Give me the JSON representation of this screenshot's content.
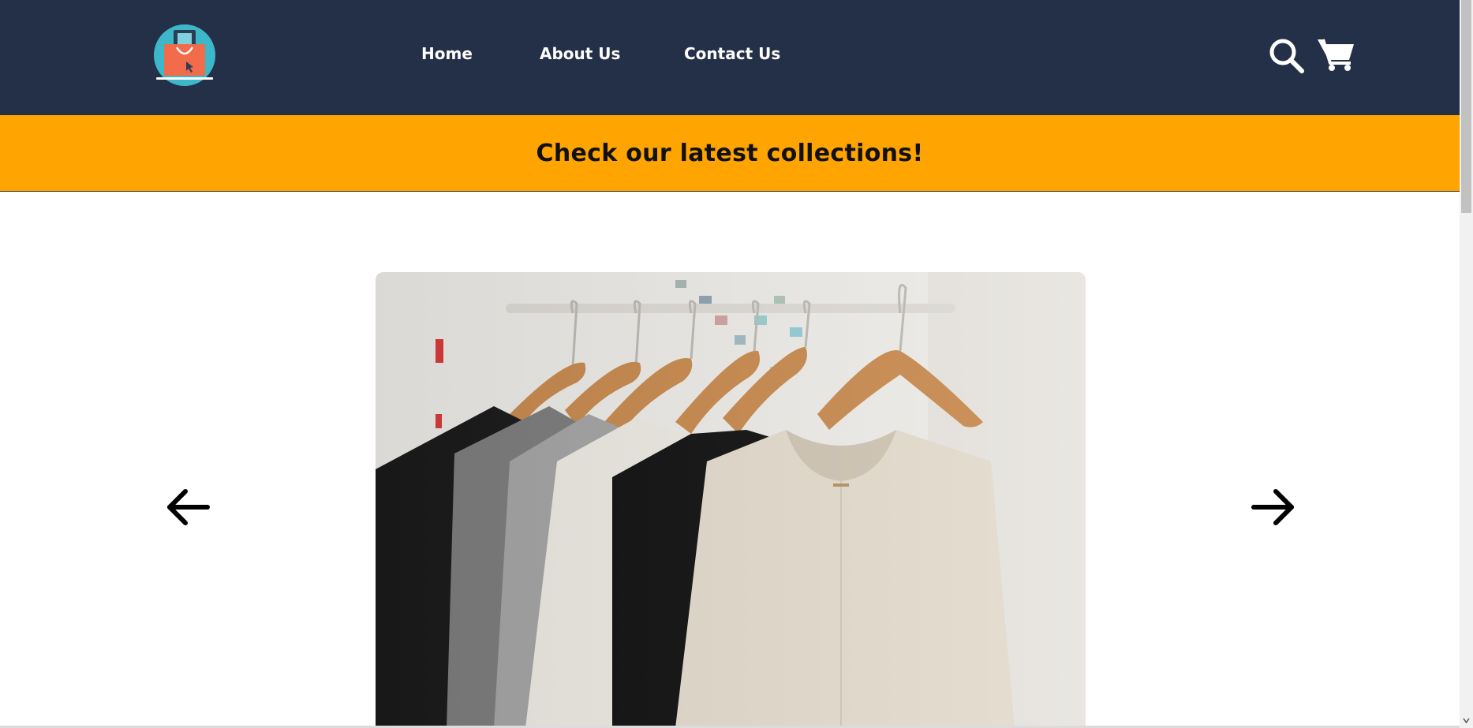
{
  "header": {
    "logo_name": "shopping-bag-logo",
    "nav": [
      {
        "label": "Home"
      },
      {
        "label": "About Us"
      },
      {
        "label": "Contact Us"
      }
    ],
    "icons": {
      "search": "search-icon",
      "cart": "cart-icon"
    }
  },
  "banner": {
    "text": "Check our latest collections!"
  },
  "carousel": {
    "prev": "arrow-left-icon",
    "next": "arrow-right-icon",
    "slide": "clothes-on-hangers-image"
  },
  "colors": {
    "header_bg": "#242f48",
    "banner_bg": "#ffa400",
    "page_bg": "#ffffff"
  }
}
